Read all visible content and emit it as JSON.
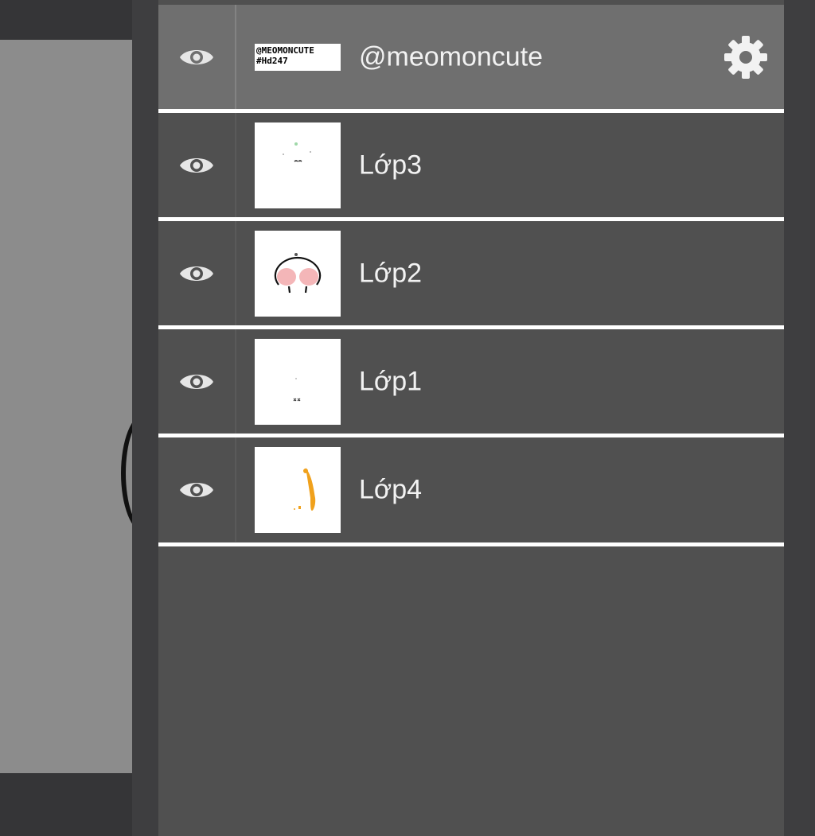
{
  "layers_panel": {
    "layers": [
      {
        "name": "@meomoncute",
        "thumbnail_text": [
          "@MEOMONCUTE",
          "#Hd247"
        ],
        "visible": true,
        "selected": true,
        "has_settings": true,
        "visibility_icon": "eye-icon",
        "settings_icon": "gear-icon"
      },
      {
        "name": "Lớp3",
        "visible": true,
        "selected": false,
        "visibility_icon": "eye-icon"
      },
      {
        "name": "Lớp2",
        "visible": true,
        "selected": false,
        "visibility_icon": "eye-icon"
      },
      {
        "name": "Lớp1",
        "visible": true,
        "selected": false,
        "visibility_icon": "eye-icon"
      },
      {
        "name": "Lớp4",
        "visible": true,
        "selected": false,
        "visibility_icon": "eye-icon"
      }
    ]
  },
  "colors": {
    "panel_bg": "#505050",
    "selected_row_bg": "#6f6f6f",
    "divider": "#ffffff",
    "text": "#f2f2f2",
    "icon": "#e6e6e6",
    "canvas_paper": "#8c8c8c",
    "thumb_pink": "#f4b6b8",
    "thumb_orange": "#f0a11c"
  }
}
